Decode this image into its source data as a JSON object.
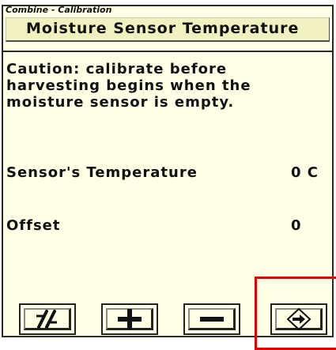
{
  "window": {
    "title": "Combine - Calibration"
  },
  "header": {
    "title": "Moisture Sensor Temperature"
  },
  "main": {
    "caution": "Caution: calibrate before harvesting begins when the moisture sensor is empty.",
    "rows": [
      {
        "label": "Sensor's Temperature",
        "value": "0 C"
      },
      {
        "label": "Offset",
        "value": "0"
      }
    ]
  },
  "softkeys": [
    {
      "name": "half-icon",
      "icon": "fraction-slash"
    },
    {
      "name": "plus-icon",
      "icon": "plus"
    },
    {
      "name": "minus-icon",
      "icon": "minus"
    },
    {
      "name": "diamond-arrow-icon",
      "icon": "diamond-right-arrow"
    }
  ],
  "highlight": {
    "color": "#e00000"
  },
  "colors": {
    "panel_background": "#ffffe6",
    "header_background": "#f0f0c0",
    "text": "#111111"
  }
}
